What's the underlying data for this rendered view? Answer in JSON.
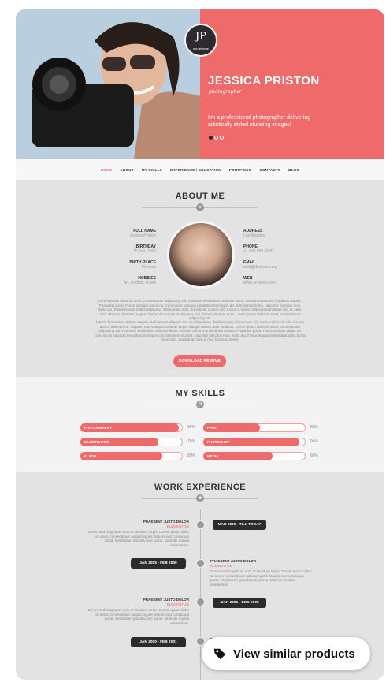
{
  "hero": {
    "logo_mono": "JP",
    "logo_tag": "my resume",
    "name": "JESSICA PRISTON",
    "role": "photographer",
    "description": "I'm a professional photographer delivering artistically styled stunning images!"
  },
  "nav": [
    "HOME",
    "ABOUT",
    "MY SKILLS",
    "EXPERIENCE / EDUCATION",
    "PORTFOLIO",
    "CONTACTS",
    "BLOG"
  ],
  "about": {
    "title": "ABOUT ME",
    "left_fields": [
      {
        "k": "FULL NAME",
        "v": "Jessica Priston"
      },
      {
        "k": "BIRTHDAY",
        "v": "25 Jun, 1990"
      },
      {
        "k": "BIRTH PLACE",
        "v": "Phoenix"
      },
      {
        "k": "HOBBIES",
        "v": "Art, Photos, Travel"
      }
    ],
    "right_fields": [
      {
        "k": "ADDRESS",
        "v": "Los Angeles"
      },
      {
        "k": "PHONE",
        "v": "+1 800 559 6580"
      },
      {
        "k": "EMAIL",
        "v": "mail@demolink.org"
      },
      {
        "k": "WEB",
        "v": "www.JPriston.com"
      }
    ],
    "para1": "Lorem ipsum dolor sit amet, consectetuer adipiscing elit. Praesent vestibulum molestie lacus. Aenean nonummy hendrerit mauris. Phasellus porta. Fusce suscipit varius mi. Cum sociis natoque penatibus et magnis dis parturient montes, nascetur ridiculus mus. Nulla dui. Fusce feugiat malesuada odio. Morbi nunc odio, gravida at, cursus nec, luctus a, lorem. Maecenas tristique orci ac sem. Duis ultricies pharetra magna. Donec accumsan malesuada orci. Donec sit amet eros. Lorem ipsum dolor sit amet, consectetuer adipiscing elit.",
    "para2": "Mauris fermentum dictum magna. Sed laoreet aliquam leo. Ut tellus dolor, dapibus eget, elementum vel, cursus eleifend, elit. Aenean auctor wisi et urna. Aliquam erat volutpat. Duis ac turpis. Integer rutrum ante eu lacus. Lorem ipsum dolor sit amet, consectetuer adipiscing elit. Praesent vestibulum molestie lacus. Aenean nonummy hendrerit mauris. Phasellus porta. Fusce suscipit varius mi. Cum sociis natoque penatibus et magnis dis parturient montes, nascetur ridiculus mus. Nulla dui. Fusce feugiat malesuada odio. Morbi nunc odio, gravida at, cursus nec, luctus a, lorem.",
    "download_label": "DOWNLOAD RESUME"
  },
  "skills": {
    "title": "MY SKILLS",
    "items": [
      {
        "name": "PHOTOGRAPHY",
        "pct": "96%",
        "level": 0.96
      },
      {
        "name": "PRINT",
        "pct": "55%",
        "level": 0.55
      },
      {
        "name": "ILLUSTRATOR",
        "pct": "76%",
        "level": 0.76
      },
      {
        "name": "PHOTOSHOP",
        "pct": "94%",
        "level": 0.94
      },
      {
        "name": "FLASH",
        "pct": "80%",
        "level": 0.8
      },
      {
        "name": "MEDIA",
        "pct": "68%",
        "level": 0.68
      }
    ]
  },
  "work": {
    "title": "WORK EXPERIENCE",
    "entries": [
      {
        "date": "MAR 2009 - TILL TODAY",
        "title": "PRAESENT JUSTO DOLOR",
        "sub": "ELEMENTUM",
        "desc": "Donec sed magna ac eros et tincidunt turpis. Dorem ipsum dolor sit amet, consectetuer adipiscing elit. Mauris sed consequat porta. Vestibulum gravida ante purus. Molestie massa elementum."
      },
      {
        "date": "JAN 2005 - FEB 2009",
        "title": "PRAESENT JUSTO DOLOR",
        "sub": "ELEMENTUM",
        "desc": "Donec sed magna ac eros et tincidunt turpis. Dorem ipsum dolor sit amet, consectetuer adipiscing elit. Mauris sed consequat porta. Vestibulum gravida ante purus. Molestie massa elementum."
      },
      {
        "date": "MAR 2001 - DEC 2005",
        "title": "PRAESENT JUSTO DOLOR",
        "sub": "ELEMENTUM",
        "desc": "Donec sed magna ac eros et tincidunt turpis. Dorem ipsum dolor sit amet, consectetuer adipiscing elit. Mauris sed consequat porta. Vestibulum gravida ante purus. Molestie massa elementum."
      },
      {
        "date": "JAN 2000 - FEB 2001",
        "title": "PRAESENT JUSTO DOLOR",
        "sub": "ELEMENTUM",
        "desc": ""
      }
    ]
  },
  "overlay": {
    "label": "View similar products",
    "icon": "tag-icon"
  },
  "colors": {
    "accent": "#ef6a6a",
    "dark": "#2d2a2e"
  }
}
